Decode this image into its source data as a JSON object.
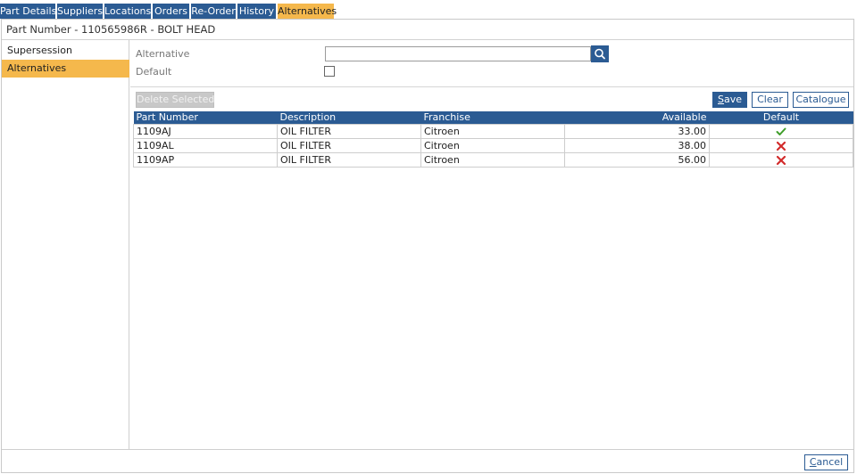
{
  "tabs": [
    {
      "label": "Part Details",
      "active": false
    },
    {
      "label": "Suppliers",
      "active": false
    },
    {
      "label": "Locations",
      "active": false
    },
    {
      "label": "Orders",
      "active": false
    },
    {
      "label": "Re-Order",
      "active": false
    },
    {
      "label": "History",
      "active": false
    },
    {
      "label": "Alternatives",
      "active": true
    }
  ],
  "header": {
    "title": "Part Number - 110565986R - BOLT HEAD"
  },
  "sidebar": {
    "items": [
      {
        "label": "Supersession",
        "active": false
      },
      {
        "label": "Alternatives",
        "active": true
      }
    ]
  },
  "form": {
    "alternative_label": "Alternative",
    "alternative_value": "",
    "default_label": "Default",
    "default_checked": false
  },
  "toolbar": {
    "delete_label": "Delete Selected",
    "save_label": "Save",
    "clear_label": "Clear",
    "catalogue_label": "Catalogue"
  },
  "table": {
    "columns": [
      "Part Number",
      "Description",
      "Franchise",
      "Available",
      "Default"
    ],
    "rows": [
      {
        "part_number": "1109AJ",
        "description": "OIL FILTER",
        "franchise": "Citroen",
        "available": "33.00",
        "default": true
      },
      {
        "part_number": "1109AL",
        "description": "OIL FILTER",
        "franchise": "Citroen",
        "available": "38.00",
        "default": false
      },
      {
        "part_number": "1109AP",
        "description": "OIL FILTER",
        "franchise": "Citroen",
        "available": "56.00",
        "default": false
      }
    ]
  },
  "footer": {
    "cancel_label": "Cancel"
  },
  "colors": {
    "primary": "#2b5b93",
    "accent": "#f5b84c",
    "check": "#3f9e2a",
    "cross": "#d22b2b"
  },
  "icons": {
    "search": "search-icon",
    "default_yes": "check-icon",
    "default_no": "cross-icon"
  }
}
